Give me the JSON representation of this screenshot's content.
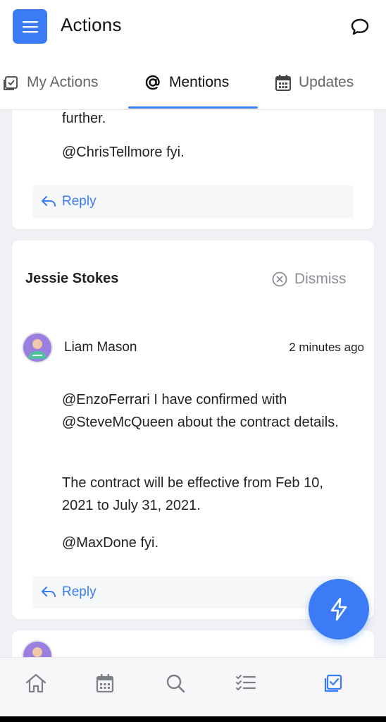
{
  "header": {
    "title": "Actions",
    "menu_icon": "hamburger-icon",
    "chat_icon": "chat-bubble-icon"
  },
  "tabs": [
    {
      "label": "My Actions",
      "icon": "checklist-icon"
    },
    {
      "label": "Mentions",
      "icon": "at-icon"
    },
    {
      "label": "Updates",
      "icon": "calendar-icon"
    }
  ],
  "card1": {
    "partial_text": "further.",
    "text": "@ChrisTellmore fyi.",
    "reply_label": "Reply"
  },
  "card2": {
    "name": "Jessie Stokes",
    "dismiss_label": "Dismiss",
    "author": "Liam Mason",
    "time": "2 minutes ago",
    "paragraphs": [
      "@EnzoFerrari I have confirmed with @SteveMcQueen about the contract details.",
      "The contract will be effective from Feb 10, 2021 to July 31, 2021.",
      "@MaxDone fyi."
    ],
    "reply_label": "Reply"
  },
  "colors": {
    "accent": "#3b7cf6",
    "background": "#f0f1f4",
    "muted": "#8a8f97"
  },
  "bottom_nav": [
    "home-icon",
    "calendar-icon",
    "search-icon",
    "tasks-icon",
    "actions-icon"
  ]
}
